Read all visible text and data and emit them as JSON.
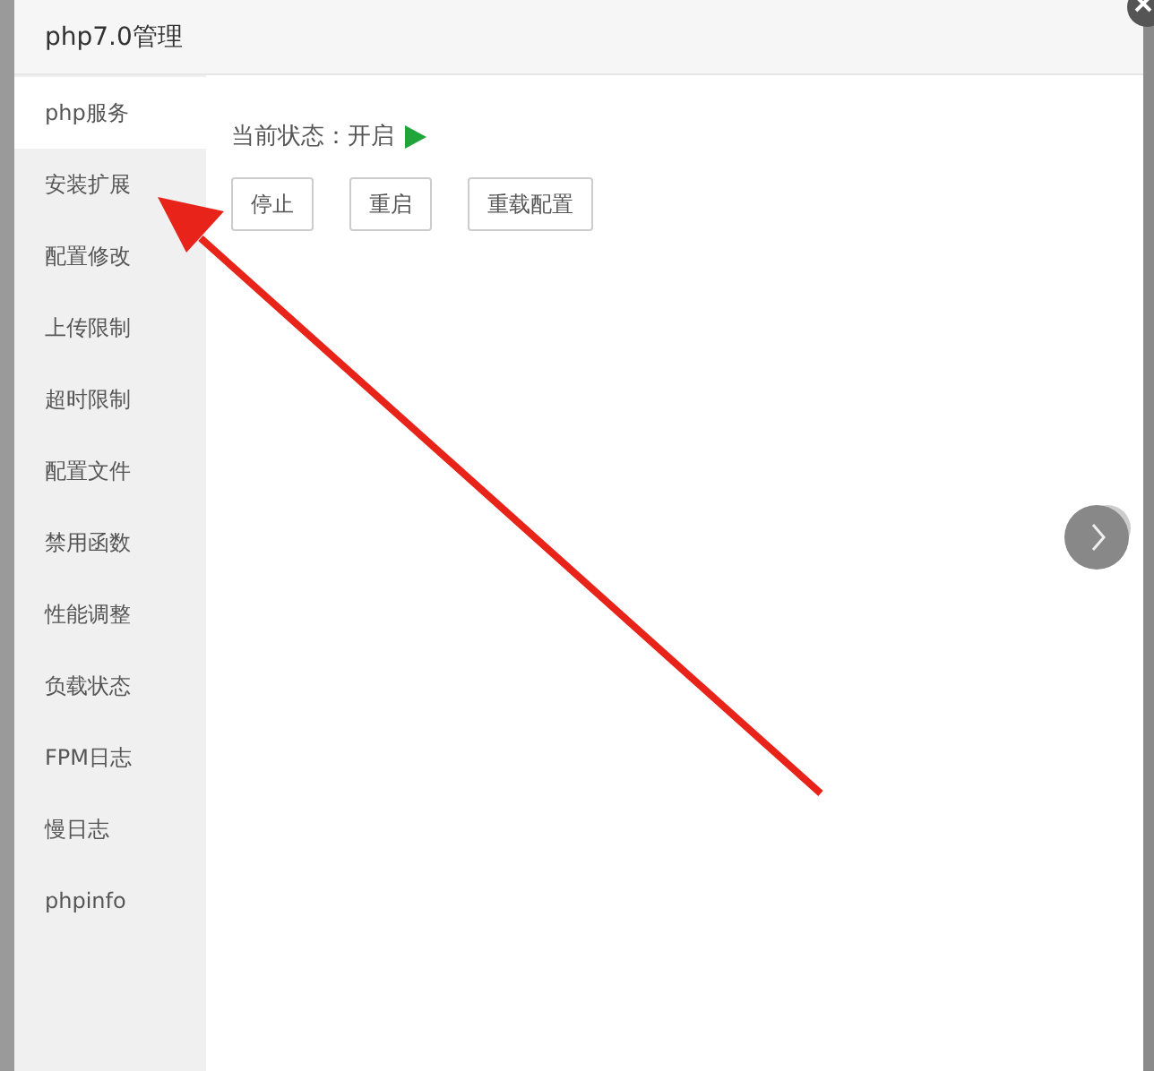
{
  "window": {
    "title": "php7.0管理"
  },
  "sidebar": {
    "items": [
      {
        "label": "php服务",
        "selected": true
      },
      {
        "label": "安装扩展",
        "selected": false
      },
      {
        "label": "配置修改",
        "selected": false
      },
      {
        "label": "上传限制",
        "selected": false
      },
      {
        "label": "超时限制",
        "selected": false
      },
      {
        "label": "配置文件",
        "selected": false
      },
      {
        "label": "禁用函数",
        "selected": false
      },
      {
        "label": "性能调整",
        "selected": false
      },
      {
        "label": "负载状态",
        "selected": false
      },
      {
        "label": "FPM日志",
        "selected": false
      },
      {
        "label": "慢日志",
        "selected": false
      },
      {
        "label": "phpinfo",
        "selected": false
      }
    ]
  },
  "status": {
    "label": "当前状态：开启",
    "running": true
  },
  "buttons": [
    "停止",
    "重启",
    "重载配置"
  ]
}
